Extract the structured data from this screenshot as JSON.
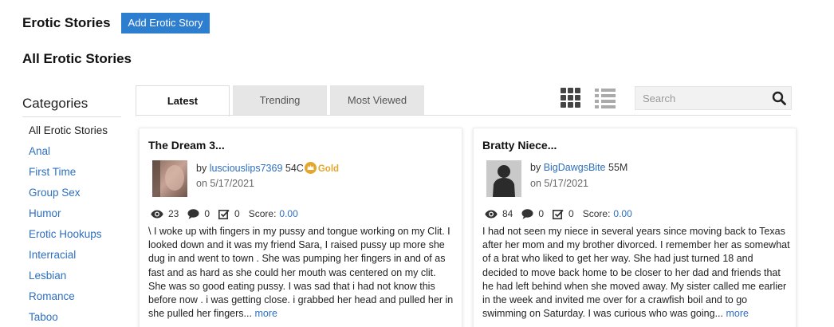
{
  "header": {
    "title": "Erotic Stories",
    "add_button": "Add Erotic Story",
    "section_title": "All Erotic Stories"
  },
  "sidebar": {
    "heading": "Categories",
    "items": [
      {
        "label": "All Erotic Stories",
        "active": true
      },
      {
        "label": "Anal"
      },
      {
        "label": "First Time"
      },
      {
        "label": "Group Sex"
      },
      {
        "label": "Humor"
      },
      {
        "label": "Erotic Hookups"
      },
      {
        "label": "Interracial"
      },
      {
        "label": "Lesbian"
      },
      {
        "label": "Romance"
      },
      {
        "label": "Taboo"
      }
    ]
  },
  "tabs": [
    {
      "label": "Latest",
      "active": true
    },
    {
      "label": "Trending"
    },
    {
      "label": "Most Viewed"
    }
  ],
  "toolbar": {
    "grid_view_icon": "grid-icon",
    "list_view_icon": "list-icon",
    "search_placeholder": "Search",
    "search_icon": "search-icon"
  },
  "stories": [
    {
      "title": "The Dream 3...",
      "by": "by",
      "author": "lusciouslips7369",
      "author_meta": "54C",
      "badge": "Gold",
      "date": "on 5/17/2021",
      "views": "23",
      "comments": "0",
      "votes": "0",
      "score_label": "Score:",
      "score": "0.00",
      "excerpt": "\\ I woke up with fingers in my pussy and tongue working on my Clit. I looked down and it was my friend Sara, I raised pussy up more she dug in and went to town . She was pumping her fingers in and of as fast and as hard as she could her mouth was centered on my clit. She was so good eating pussy. I was sad that i had not know this before now . i was getting close. i grabbed her head and pulled her in she pulled her fingers...",
      "more": "more"
    },
    {
      "title": "Bratty Niece...",
      "by": "by",
      "author": "BigDawgsBite",
      "author_meta": "55M",
      "date": "on 5/17/2021",
      "views": "84",
      "comments": "0",
      "votes": "0",
      "score_label": "Score:",
      "score": "0.00",
      "excerpt": "I had not seen my niece in several years since moving back to Texas after her mom and my brother divorced. I remember her as somewhat of a brat who liked to get her way. She had just turned 18 and decided to move back home to be closer to her dad and friends that he had left behind when she moved away. My sister called me earlier in the week and invited me over for a crawfish boil and to go swimming on Saturday. I was curious who was going...",
      "more": "more"
    }
  ],
  "colors": {
    "accent": "#2e7ecf",
    "link": "#2e6fc0",
    "gold": "#e2a72c"
  }
}
